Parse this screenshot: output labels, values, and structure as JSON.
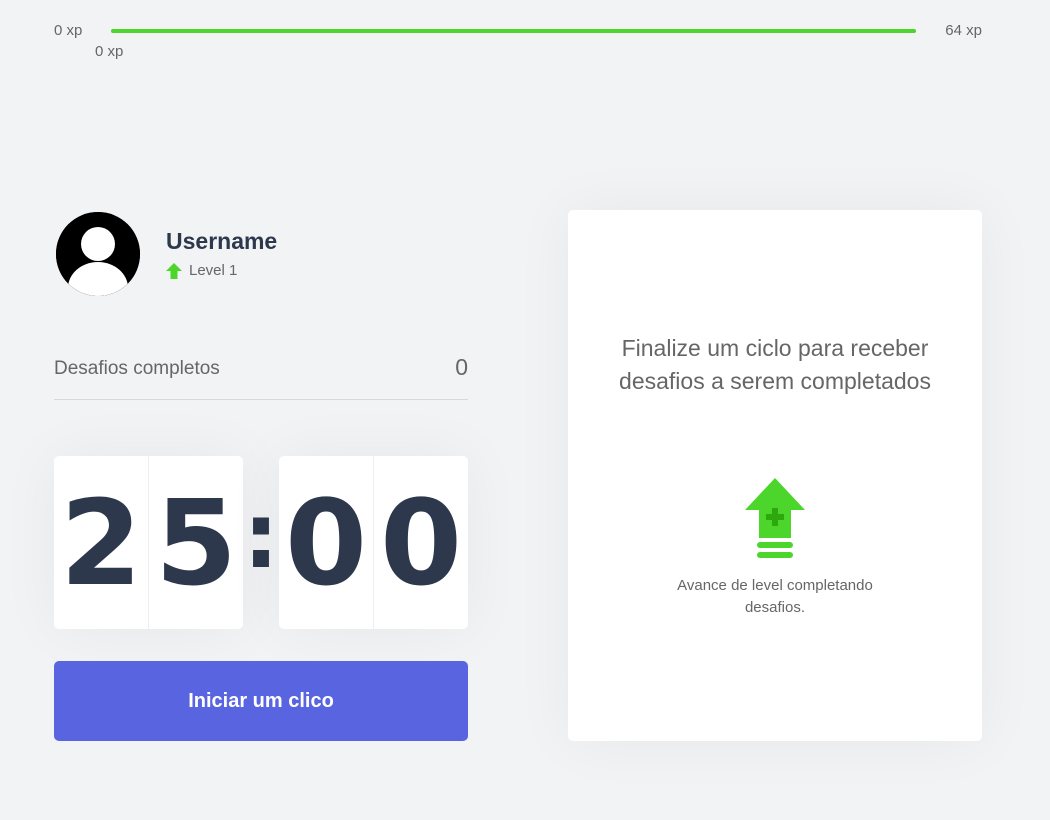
{
  "xp": {
    "min_label": "0 xp",
    "max_label": "64 xp",
    "current_label": "0 xp",
    "progress_fraction": 1.0,
    "bar_color": "#4cd62b"
  },
  "profile": {
    "avatar_icon": "user-avatar-icon",
    "name": "Username",
    "level_icon": "level-up-arrow-icon",
    "level": "Level 1"
  },
  "completed_challenges": {
    "label": "Desafios completos",
    "count": "0"
  },
  "countdown": {
    "minute_left": "2",
    "minute_right": "5",
    "separator": ":",
    "second_left": "0",
    "second_right": "0"
  },
  "start_button": {
    "label": "Iniciar um clico",
    "color": "#5965e0"
  },
  "challenge_box": {
    "title": "Finalize um ciclo para receber desafios a serem completados",
    "icon": "level-up-icon",
    "hint": "Avance de level completando desafios."
  }
}
